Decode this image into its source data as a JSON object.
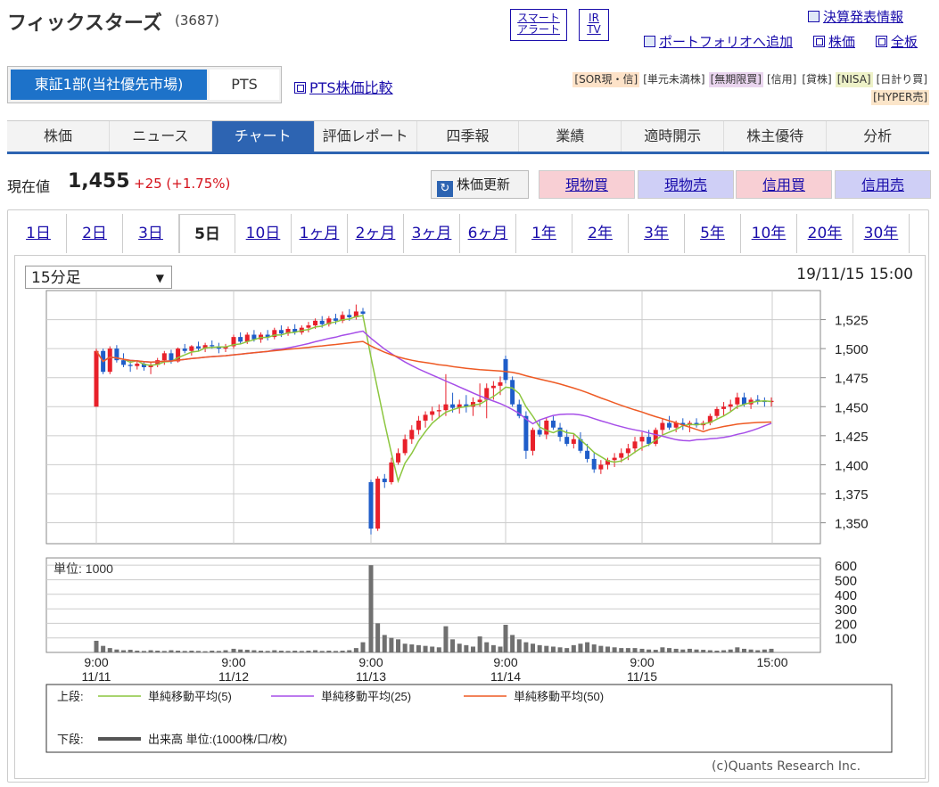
{
  "header": {
    "company": "フィックスターズ",
    "code": "(3687)",
    "smart_alert_l1": "スマート",
    "smart_alert_l2": "アラート",
    "irtv_l1": "IR",
    "irtv_l2": "TV",
    "earnings_link": "決算発表情報",
    "portfolio_link": "ポートフォリオへ追加",
    "stockprice_link": "株価",
    "fullboard_link": "全板"
  },
  "market_tabs": {
    "tse": "東証1部(当社優先市場)",
    "pts": "PTS",
    "pts_compare": "PTS株価比較"
  },
  "tags": [
    {
      "label": "[SOR現・信]",
      "color": "#fde2c8"
    },
    {
      "label": "[単元未満株]",
      "color": "#ffffff"
    },
    {
      "label": "[無期限買]",
      "color": "#ead5ef"
    },
    {
      "label": "[信用]",
      "color": "#ffffff"
    },
    {
      "label": "[貸株]",
      "color": "#ffffff"
    },
    {
      "label": "[NISA]",
      "color": "#eef2c8"
    },
    {
      "label": "[日計り買]",
      "color": "#ffffff"
    },
    {
      "label": "[HYPER売]",
      "color": "#fbe5c9"
    }
  ],
  "nav": [
    "株価",
    "ニュース",
    "チャート",
    "評価レポート",
    "四季報",
    "業績",
    "適時開示",
    "株主優待",
    "分析"
  ],
  "nav_active": "チャート",
  "price": {
    "label": "現在値",
    "value": "1,455",
    "change": "+25 (+1.75%)",
    "refresh": "株価更新"
  },
  "trade_buttons": [
    "現物買",
    "現物売",
    "信用買",
    "信用売"
  ],
  "periods": [
    "1日",
    "2日",
    "3日",
    "5日",
    "10日",
    "1ヶ月",
    "2ヶ月",
    "3ヶ月",
    "6ヶ月",
    "1年",
    "2年",
    "3年",
    "5年",
    "10年",
    "20年",
    "30年"
  ],
  "period_active": "5日",
  "interval_select": "15分足",
  "timestamp": "19/11/15 15:00",
  "credit": "(c)Quants Research Inc.",
  "chart_data": {
    "type": "candlestick",
    "price_axis": {
      "ticks": [
        "1,525",
        "1,500",
        "1,475",
        "1,450",
        "1,425",
        "1,400",
        "1,375",
        "1,350"
      ],
      "values": [
        1525,
        1500,
        1475,
        1450,
        1425,
        1400,
        1375,
        1350
      ],
      "ylim": [
        1332,
        1550
      ]
    },
    "volume_axis": {
      "unit_label": "単位: 1000",
      "ticks": [
        "600",
        "500",
        "400",
        "300",
        "200",
        "100"
      ],
      "values": [
        600,
        500,
        400,
        300,
        200,
        100
      ],
      "ylim": [
        0,
        650
      ]
    },
    "x_ticks": [
      {
        "time": "9:00",
        "date": "11/11"
      },
      {
        "time": "9:00",
        "date": "11/12"
      },
      {
        "time": "9:00",
        "date": "11/13"
      },
      {
        "time": "9:00",
        "date": "11/14"
      },
      {
        "time": "9:00",
        "date": "11/15"
      },
      {
        "time": "15:00",
        "date": ""
      }
    ],
    "bars_per_day": 20,
    "ohlc": [
      [
        1450,
        1500,
        1450,
        1498
      ],
      [
        1498,
        1500,
        1478,
        1480
      ],
      [
        1480,
        1502,
        1478,
        1500
      ],
      [
        1500,
        1503,
        1488,
        1490
      ],
      [
        1490,
        1496,
        1484,
        1486
      ],
      [
        1486,
        1490,
        1480,
        1485
      ],
      [
        1485,
        1490,
        1482,
        1487
      ],
      [
        1487,
        1489,
        1481,
        1484
      ],
      [
        1484,
        1488,
        1478,
        1486
      ],
      [
        1486,
        1492,
        1484,
        1490
      ],
      [
        1490,
        1498,
        1486,
        1496
      ],
      [
        1496,
        1499,
        1487,
        1489
      ],
      [
        1489,
        1501,
        1488,
        1500
      ],
      [
        1500,
        1504,
        1496,
        1498
      ],
      [
        1498,
        1503,
        1494,
        1502
      ],
      [
        1502,
        1506,
        1498,
        1500
      ],
      [
        1500,
        1505,
        1497,
        1503
      ],
      [
        1503,
        1507,
        1500,
        1502
      ],
      [
        1502,
        1505,
        1496,
        1500
      ],
      [
        1500,
        1504,
        1497,
        1502
      ],
      [
        1502,
        1512,
        1500,
        1510
      ],
      [
        1510,
        1514,
        1504,
        1506
      ],
      [
        1506,
        1514,
        1504,
        1512
      ],
      [
        1512,
        1516,
        1506,
        1508
      ],
      [
        1508,
        1514,
        1505,
        1512
      ],
      [
        1512,
        1516,
        1507,
        1510
      ],
      [
        1510,
        1518,
        1508,
        1516
      ],
      [
        1516,
        1520,
        1510,
        1513
      ],
      [
        1513,
        1519,
        1511,
        1517
      ],
      [
        1517,
        1521,
        1512,
        1514
      ],
      [
        1514,
        1520,
        1512,
        1518
      ],
      [
        1518,
        1523,
        1514,
        1520
      ],
      [
        1520,
        1526,
        1517,
        1524
      ],
      [
        1524,
        1528,
        1518,
        1521
      ],
      [
        1521,
        1528,
        1519,
        1526
      ],
      [
        1526,
        1530,
        1521,
        1524
      ],
      [
        1524,
        1532,
        1522,
        1529
      ],
      [
        1529,
        1534,
        1524,
        1527
      ],
      [
        1527,
        1538,
        1525,
        1532
      ],
      [
        1532,
        1535,
        1526,
        1530
      ],
      [
        1385,
        1387,
        1340,
        1345
      ],
      [
        1345,
        1390,
        1343,
        1388
      ],
      [
        1388,
        1392,
        1380,
        1385
      ],
      [
        1385,
        1406,
        1383,
        1402
      ],
      [
        1402,
        1414,
        1400,
        1410
      ],
      [
        1410,
        1426,
        1408,
        1422
      ],
      [
        1422,
        1434,
        1418,
        1430
      ],
      [
        1430,
        1442,
        1426,
        1438
      ],
      [
        1438,
        1446,
        1432,
        1443
      ],
      [
        1443,
        1450,
        1438,
        1446
      ],
      [
        1446,
        1452,
        1440,
        1447
      ],
      [
        1447,
        1478,
        1442,
        1452
      ],
      [
        1452,
        1462,
        1445,
        1449
      ],
      [
        1449,
        1456,
        1444,
        1452
      ],
      [
        1452,
        1460,
        1445,
        1450
      ],
      [
        1450,
        1458,
        1442,
        1454
      ],
      [
        1454,
        1470,
        1450,
        1456
      ],
      [
        1456,
        1470,
        1440,
        1466
      ],
      [
        1466,
        1472,
        1456,
        1468
      ],
      [
        1468,
        1476,
        1460,
        1471
      ],
      [
        1491,
        1494,
        1470,
        1473
      ],
      [
        1473,
        1476,
        1450,
        1452
      ],
      [
        1452,
        1456,
        1440,
        1442
      ],
      [
        1442,
        1446,
        1405,
        1412
      ],
      [
        1412,
        1432,
        1408,
        1430
      ],
      [
        1430,
        1438,
        1424,
        1426
      ],
      [
        1426,
        1441,
        1422,
        1438
      ],
      [
        1438,
        1442,
        1430,
        1432
      ],
      [
        1432,
        1436,
        1420,
        1424
      ],
      [
        1424,
        1430,
        1416,
        1418
      ],
      [
        1418,
        1426,
        1414,
        1422
      ],
      [
        1422,
        1428,
        1410,
        1412
      ],
      [
        1412,
        1418,
        1402,
        1405
      ],
      [
        1405,
        1410,
        1393,
        1396
      ],
      [
        1396,
        1404,
        1392,
        1400
      ],
      [
        1400,
        1406,
        1396,
        1404
      ],
      [
        1404,
        1410,
        1398,
        1406
      ],
      [
        1406,
        1414,
        1402,
        1410
      ],
      [
        1410,
        1418,
        1404,
        1414
      ],
      [
        1414,
        1424,
        1410,
        1420
      ],
      [
        1420,
        1428,
        1412,
        1424
      ],
      [
        1424,
        1430,
        1416,
        1418
      ],
      [
        1418,
        1432,
        1416,
        1430
      ],
      [
        1430,
        1440,
        1426,
        1436
      ],
      [
        1436,
        1442,
        1430,
        1432
      ],
      [
        1432,
        1438,
        1428,
        1436
      ],
      [
        1436,
        1440,
        1430,
        1434
      ],
      [
        1434,
        1438,
        1428,
        1436
      ],
      [
        1436,
        1440,
        1432,
        1434
      ],
      [
        1434,
        1438,
        1430,
        1436
      ],
      [
        1436,
        1444,
        1434,
        1442
      ],
      [
        1442,
        1450,
        1440,
        1448
      ],
      [
        1448,
        1454,
        1442,
        1450
      ],
      [
        1450,
        1456,
        1446,
        1452
      ],
      [
        1452,
        1462,
        1448,
        1458
      ],
      [
        1458,
        1462,
        1450,
        1452
      ],
      [
        1452,
        1458,
        1448,
        1456
      ],
      [
        1456,
        1460,
        1452,
        1455
      ],
      [
        1455,
        1458,
        1450,
        1454
      ],
      [
        1454,
        1458,
        1450,
        1455
      ]
    ],
    "volume": [
      80,
      45,
      30,
      20,
      15,
      18,
      12,
      10,
      15,
      12,
      10,
      15,
      12,
      10,
      12,
      10,
      8,
      12,
      10,
      15,
      25,
      20,
      18,
      15,
      12,
      10,
      15,
      12,
      10,
      12,
      10,
      12,
      15,
      10,
      12,
      10,
      12,
      15,
      30,
      70,
      600,
      200,
      120,
      100,
      90,
      60,
      55,
      50,
      45,
      40,
      35,
      180,
      90,
      60,
      50,
      40,
      110,
      70,
      50,
      40,
      190,
      120,
      90,
      70,
      60,
      50,
      45,
      40,
      35,
      30,
      50,
      60,
      70,
      55,
      45,
      40,
      35,
      30,
      30,
      30,
      25,
      20,
      18,
      35,
      30,
      25,
      20,
      25,
      20,
      18,
      15,
      12,
      15,
      20,
      35,
      25,
      20,
      15,
      20,
      25
    ],
    "ma_series": [
      {
        "name": "単純移動平均(5)",
        "period": 5,
        "color": "#8cc63f"
      },
      {
        "name": "単純移動平均(25)",
        "period": 25,
        "color": "#a64ee8"
      },
      {
        "name": "単純移動平均(50)",
        "period": 50,
        "color": "#ee5a24"
      }
    ],
    "legend": {
      "upper_label": "上段:",
      "lower_label": "下段:",
      "volume_label": "出来高 単位:(1000株/口/枚)"
    }
  }
}
